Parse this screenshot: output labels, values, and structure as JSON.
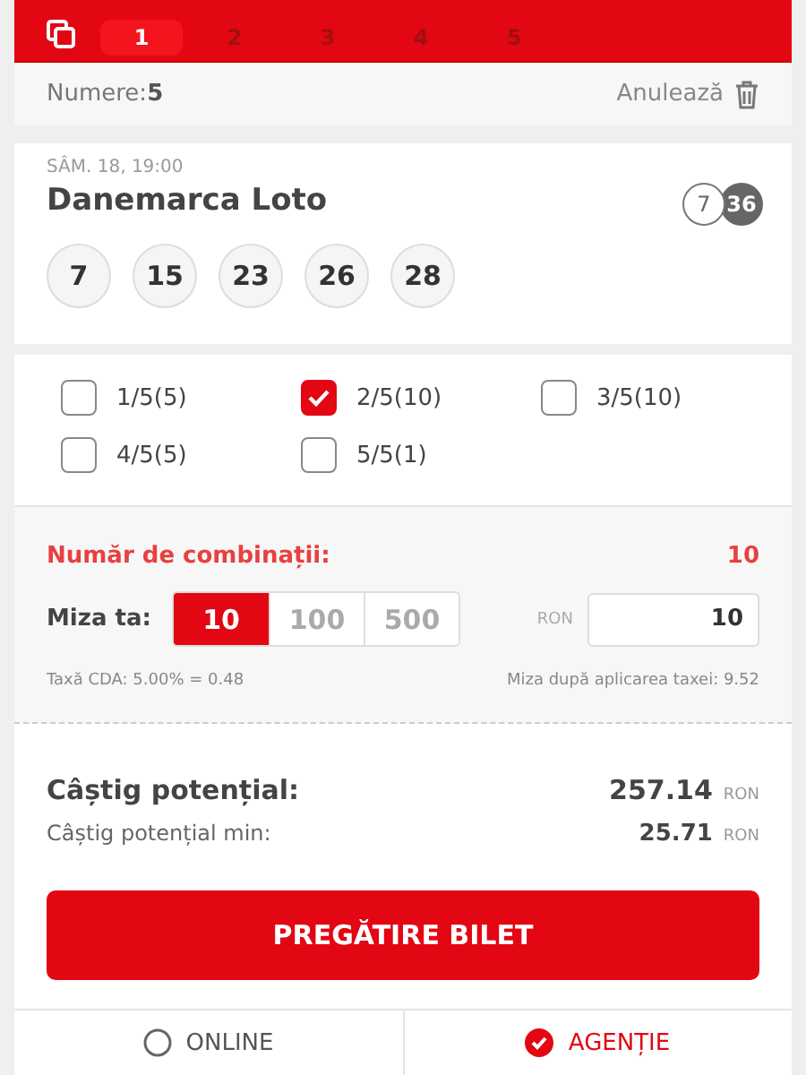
{
  "ticket_tabs": [
    {
      "label": "1",
      "selected": true
    },
    {
      "label": "2",
      "selected": false
    },
    {
      "label": "3",
      "selected": false
    },
    {
      "label": "4",
      "selected": false
    },
    {
      "label": "5",
      "selected": false
    }
  ],
  "numbers_bar": {
    "label": "Numere:",
    "count": "5",
    "cancel": "Anulează"
  },
  "draw": {
    "date": "SÂM. 18, 19:00",
    "name": "Danemarca Loto",
    "format": [
      "7",
      "36"
    ],
    "balls": [
      "7",
      "15",
      "23",
      "26",
      "28"
    ]
  },
  "systems": [
    {
      "label": "1/5(5)",
      "checked": false
    },
    {
      "label": "2/5(10)",
      "checked": true
    },
    {
      "label": "3/5(10)",
      "checked": false
    },
    {
      "label": "4/5(5)",
      "checked": false
    },
    {
      "label": "5/5(1)",
      "checked": false
    }
  ],
  "combinations": {
    "label": "Număr de combinații:",
    "value": "10"
  },
  "stake": {
    "label": "Miza ta:",
    "presets": [
      {
        "label": "10",
        "selected": true
      },
      {
        "label": "100",
        "selected": false
      },
      {
        "label": "500",
        "selected": false
      }
    ],
    "currency": "RON",
    "value": "10"
  },
  "tax": {
    "left": "Taxă CDA: 5.00% = 0.48",
    "right": "Miza după aplicarea taxei: 9.52"
  },
  "winnings": [
    {
      "kind": "main",
      "label": "Câștig potențial:",
      "value": "257.14",
      "currency": "RON"
    },
    {
      "kind": "min",
      "label": "Câștig potențial min:",
      "value": "25.71",
      "currency": "RON"
    }
  ],
  "submit": "PREGĂTIRE BILET",
  "channels": [
    {
      "label": "ONLINE",
      "selected": false
    },
    {
      "label": "AGENȚIE",
      "selected": true
    }
  ]
}
